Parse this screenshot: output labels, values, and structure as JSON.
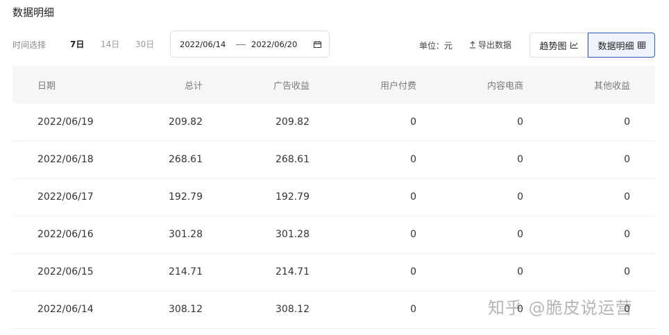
{
  "page": {
    "title": "数据明细"
  },
  "toolbar": {
    "time_label": "时间选择",
    "ranges": [
      {
        "label": "7日",
        "active": true
      },
      {
        "label": "14日",
        "active": false
      },
      {
        "label": "30日",
        "active": false
      }
    ],
    "date_start": "2022/06/14",
    "date_end": "2022/06/20",
    "unit_label": "单位：元",
    "export_label": "导出数据",
    "view_trend_label": "趋势图",
    "view_detail_label": "数据明细",
    "active_view": "数据明细",
    "accent_color": "#2d5cbe"
  },
  "table": {
    "columns": [
      "日期",
      "总计",
      "广告收益",
      "用户付费",
      "内容电商",
      "其他收益"
    ],
    "rows": [
      [
        "2022/06/19",
        "209.82",
        "209.82",
        "0",
        "0",
        "0"
      ],
      [
        "2022/06/18",
        "268.61",
        "268.61",
        "0",
        "0",
        "0"
      ],
      [
        "2022/06/17",
        "192.79",
        "192.79",
        "0",
        "0",
        "0"
      ],
      [
        "2022/06/16",
        "301.28",
        "301.28",
        "0",
        "0",
        "0"
      ],
      [
        "2022/06/15",
        "214.71",
        "214.71",
        "0",
        "0",
        "0"
      ],
      [
        "2022/06/14",
        "308.12",
        "308.12",
        "0",
        "0",
        "0"
      ]
    ]
  },
  "watermark": "知乎 @脆皮说运营"
}
